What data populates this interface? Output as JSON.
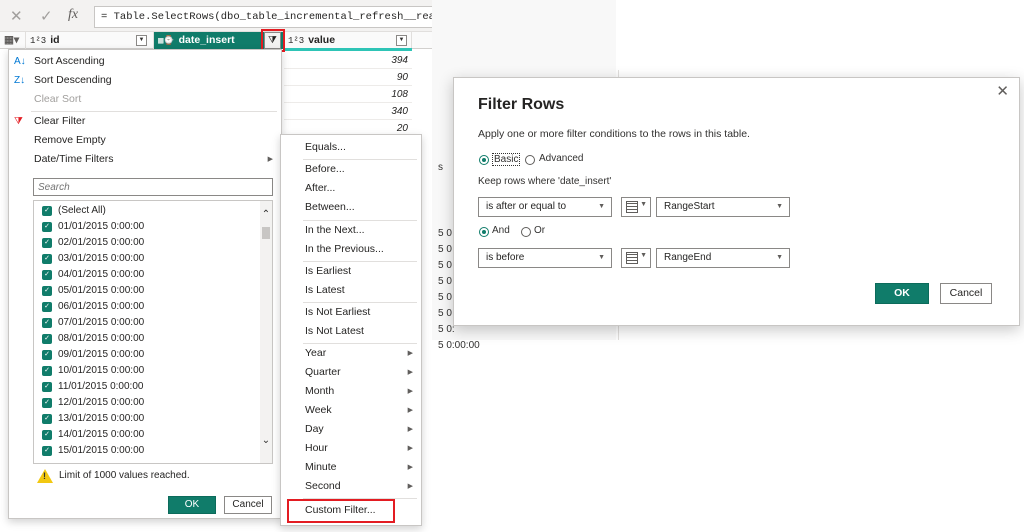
{
  "formula_bar": {
    "cancel_icon": "x-icon",
    "commit_icon": "check-icon",
    "fx_label": "fx",
    "formula": "= Table.SelectRows(dbo_table_incremental_refresh__realtime, each"
  },
  "columns": [
    {
      "type_label": "1²3",
      "name": "id"
    },
    {
      "type_label": "",
      "name": "date_insert"
    },
    {
      "type_label": "1²3",
      "name": "value"
    }
  ],
  "value_cells": [
    "394",
    "90",
    "108",
    "340",
    "20"
  ],
  "filter_menu": {
    "sort_ascending": "Sort Ascending",
    "sort_descending": "Sort Descending",
    "clear_sort": "Clear Sort",
    "clear_filter": "Clear Filter",
    "remove_empty": "Remove Empty",
    "datetime_filters": "Date/Time Filters",
    "search_placeholder": "Search",
    "select_all": "(Select All)",
    "values": [
      "01/01/2015 0:00:00",
      "02/01/2015 0:00:00",
      "03/01/2015 0:00:00",
      "04/01/2015 0:00:00",
      "05/01/2015 0:00:00",
      "06/01/2015 0:00:00",
      "07/01/2015 0:00:00",
      "08/01/2015 0:00:00",
      "09/01/2015 0:00:00",
      "10/01/2015 0:00:00",
      "11/01/2015 0:00:00",
      "12/01/2015 0:00:00",
      "13/01/2015 0:00:00",
      "14/01/2015 0:00:00",
      "15/01/2015 0:00:00"
    ],
    "limit_message": "Limit of 1000 values reached.",
    "ok_label": "OK",
    "cancel_label": "Cancel"
  },
  "datetime_submenu": {
    "items": [
      {
        "label": "Equals...",
        "arrow": false
      },
      {
        "label": "Before...",
        "arrow": false
      },
      {
        "label": "After...",
        "arrow": false
      },
      {
        "label": "Between...",
        "arrow": false
      },
      {
        "label": "In the Next...",
        "arrow": false
      },
      {
        "label": "In the Previous...",
        "arrow": false
      },
      {
        "label": "Is Earliest",
        "arrow": false
      },
      {
        "label": "Is Latest",
        "arrow": false
      },
      {
        "label": "Is Not Earliest",
        "arrow": false
      },
      {
        "label": "Is Not Latest",
        "arrow": false
      },
      {
        "label": "Year",
        "arrow": true
      },
      {
        "label": "Quarter",
        "arrow": true
      },
      {
        "label": "Month",
        "arrow": true
      },
      {
        "label": "Week",
        "arrow": true
      },
      {
        "label": "Day",
        "arrow": true
      },
      {
        "label": "Hour",
        "arrow": true
      },
      {
        "label": "Minute",
        "arrow": true
      },
      {
        "label": "Second",
        "arrow": true
      },
      {
        "label": "Custom Filter...",
        "arrow": false
      }
    ]
  },
  "background_fragments": [
    "s",
    "5 0",
    "5 0",
    "5 0",
    "5 0",
    "5 0",
    "5 0",
    "5 0:",
    "5 0:00:00"
  ],
  "dialog": {
    "title": "Filter Rows",
    "description": "Apply one or more filter conditions to the rows in this table.",
    "mode_basic": "Basic",
    "mode_advanced": "Advanced",
    "keep_rows": "Keep rows where 'date_insert'",
    "condition1_operator": "is after or equal to",
    "condition1_value": "RangeStart",
    "logic_and": "And",
    "logic_or": "Or",
    "condition2_operator": "is before",
    "condition2_value": "RangeEnd",
    "ok_label": "OK",
    "cancel_label": "Cancel",
    "close_icon": "close-icon"
  },
  "colors": {
    "accent": "#107c6a",
    "highlight": "#e31c22",
    "value_header_underline": "#2ec4b6"
  }
}
